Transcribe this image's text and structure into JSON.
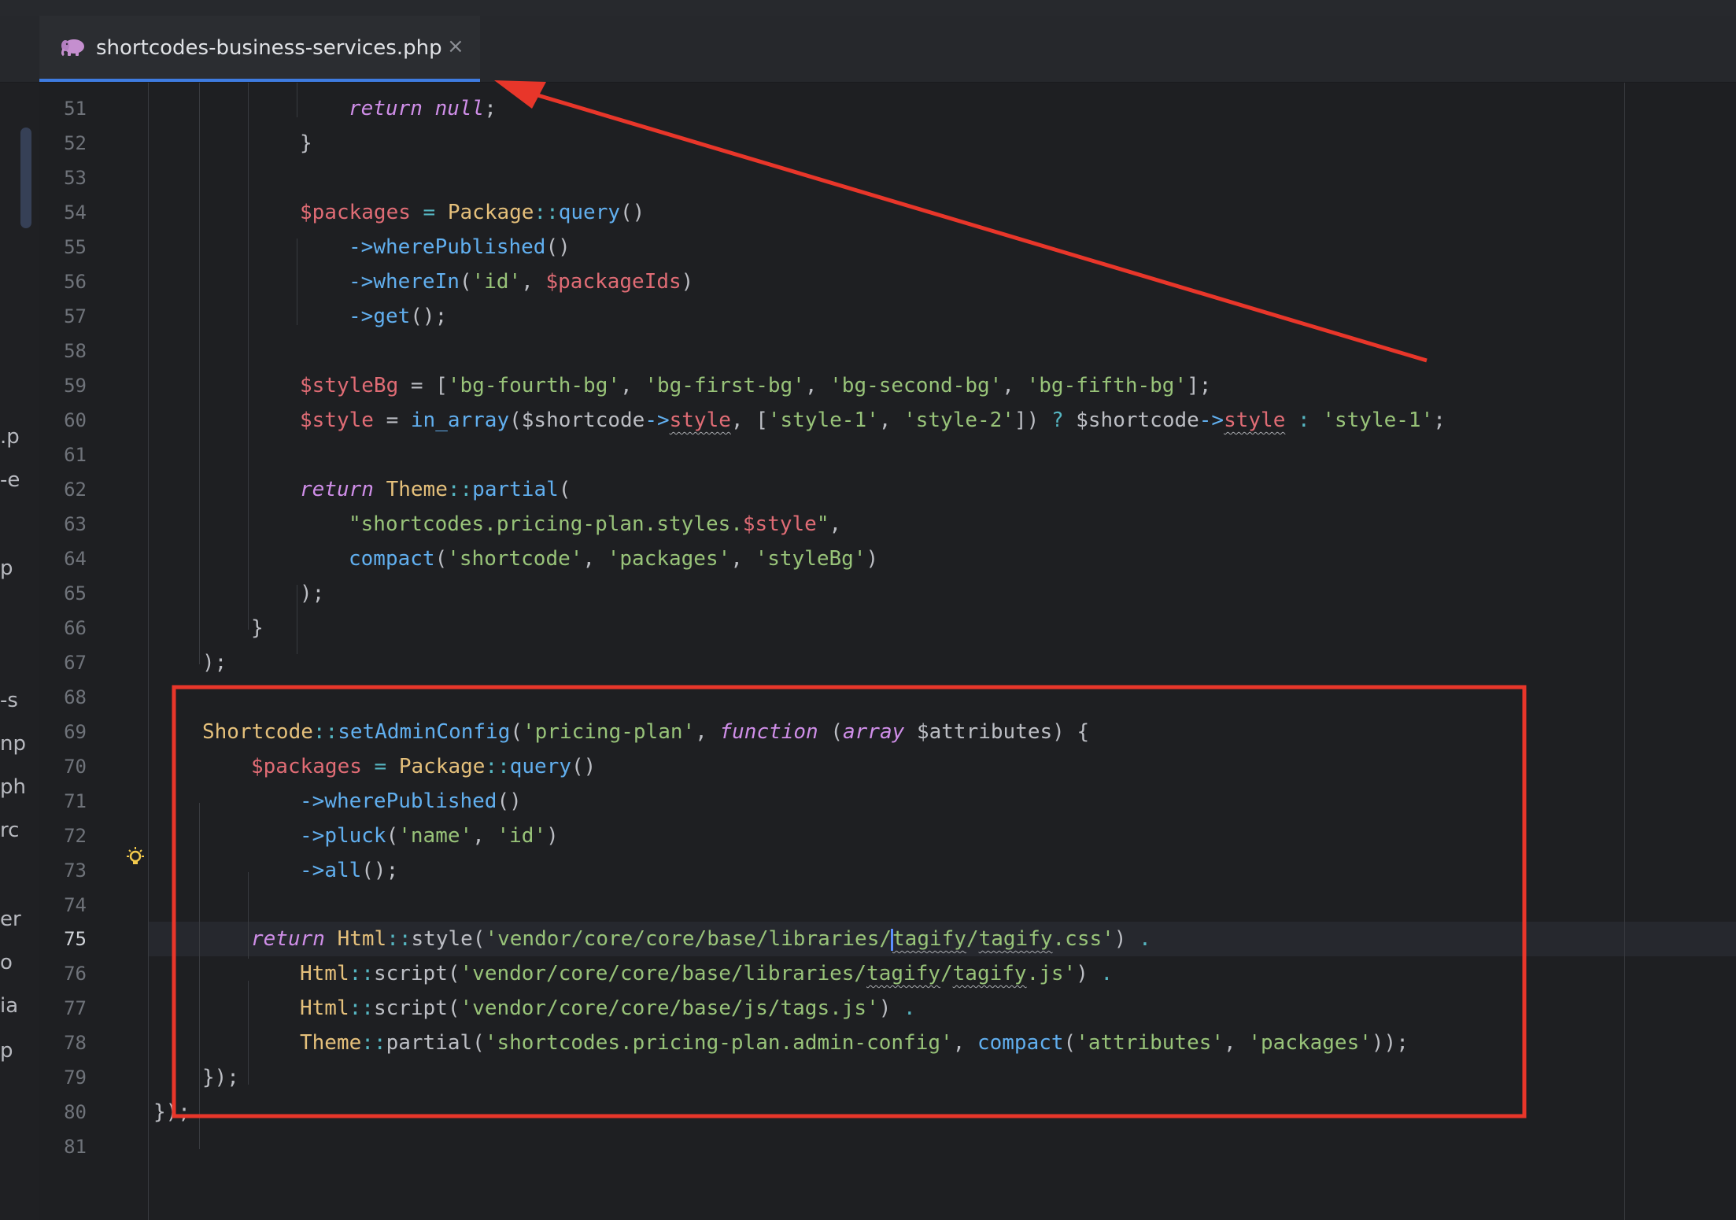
{
  "tab": {
    "file_name": "shortcodes-business-services.php",
    "close_symbol": "×",
    "icon": "php-elephant-icon"
  },
  "left_panel_fragments": [
    ".p",
    "-e",
    "p",
    "-s",
    "np",
    "ph",
    "rc",
    "er",
    "o",
    "ia",
    "p"
  ],
  "editor": {
    "active_line": "75",
    "line_numbers": [
      "51",
      "52",
      "53",
      "54",
      "55",
      "56",
      "57",
      "58",
      "59",
      "60",
      "61",
      "62",
      "63",
      "64",
      "65",
      "66",
      "67",
      "68",
      "69",
      "70",
      "71",
      "72",
      "73",
      "74",
      "75",
      "76",
      "77",
      "78",
      "79",
      "80",
      "81"
    ],
    "code": {
      "l51": {
        "a": "return",
        "b": " ",
        "c": "null",
        "d": ";"
      },
      "l52": {
        "a": "}"
      },
      "l54": {
        "a": "$packages",
        "b": " = ",
        "c": "Package",
        "d": "::",
        "e": "query",
        "f": "()"
      },
      "l55": {
        "a": "->",
        "b": "wherePublished",
        "c": "()"
      },
      "l56": {
        "a": "->",
        "b": "whereIn",
        "c": "(",
        "d": "'id'",
        "e": ", ",
        "f": "$packageIds",
        "g": ")"
      },
      "l57": {
        "a": "->",
        "b": "get",
        "c": "();"
      },
      "l59": {
        "a": "$styleBg",
        "b": " = [",
        "c": "'bg-fourth-bg'",
        "d": ", ",
        "e": "'bg-first-bg'",
        "f": ", ",
        "g": "'bg-second-bg'",
        "h": ", ",
        "i": "'bg-fifth-bg'",
        "j": "];"
      },
      "l60": {
        "a": "$style",
        "b": " = ",
        "c": "in_array",
        "d": "($shortcode",
        "e": "->",
        "f": "style",
        "g": ", [",
        "h": "'style-1'",
        "i": ", ",
        "j": "'style-2'",
        "k": "]) ",
        "l": "?",
        "m": " $shortcode",
        "n": "->",
        "o": "style",
        "p": " ",
        "q": ":",
        "r": " ",
        "s": "'style-1'",
        "t": ";"
      },
      "l62": {
        "a": "return",
        "b": " ",
        "c": "Theme",
        "d": "::",
        "e": "partial",
        "f": "("
      },
      "l63": {
        "a": "\"shortcodes.pricing-plan.styles.",
        "b": "$style",
        "c": "\"",
        "d": ","
      },
      "l64": {
        "a": "compact",
        "b": "(",
        "c": "'shortcode'",
        "d": ", ",
        "e": "'packages'",
        "f": ", ",
        "g": "'styleBg'",
        "h": ")"
      },
      "l65": {
        "a": ");"
      },
      "l66": {
        "a": "}"
      },
      "l67": {
        "a": ");"
      },
      "l69": {
        "a": "Shortcode",
        "b": "::",
        "c": "setAdminConfig",
        "d": "(",
        "e": "'pricing-plan'",
        "f": ", ",
        "g": "function",
        "h": " (",
        "i": "array",
        "j": " $attributes) {"
      },
      "l70": {
        "a": "$packages",
        "b": " = ",
        "c": "Package",
        "d": "::",
        "e": "query",
        "f": "()"
      },
      "l71": {
        "a": "->",
        "b": "wherePublished",
        "c": "()"
      },
      "l72": {
        "a": "->",
        "b": "pluck",
        "c": "(",
        "d": "'name'",
        "e": ", ",
        "f": "'id'",
        "g": ")"
      },
      "l73": {
        "a": "->",
        "b": "all",
        "c": "();"
      },
      "l75": {
        "a": "return",
        "b": " ",
        "c": "Html",
        "d": "::",
        "e": "style",
        "f": "(",
        "g": "'vendor/core/core/base/libraries/",
        "h": "tagify",
        "i": "/",
        "j": "tagify",
        "k": ".css'",
        "l": ") ",
        "m": "."
      },
      "l76": {
        "a": "Html",
        "b": "::",
        "c": "script",
        "d": "(",
        "e": "'vendor/core/core/base/libraries/",
        "f": "tagify",
        "g": "/",
        "h": "tagify",
        "i": ".js'",
        "j": ") ",
        "k": "."
      },
      "l77": {
        "a": "Html",
        "b": "::",
        "c": "script",
        "d": "(",
        "e": "'vendor/core/core/base/js/tags.js'",
        "f": ") ",
        "g": "."
      },
      "l78": {
        "a": "Theme",
        "b": "::",
        "c": "partial",
        "d": "(",
        "e": "'shortcodes.pricing-plan.admin-config'",
        "f": ", ",
        "g": "compact",
        "h": "(",
        "i": "'attributes'",
        "j": ", ",
        "k": "'packages'",
        "l": "));"
      },
      "l79": {
        "a": "});"
      },
      "l80": {
        "a": "});"
      }
    }
  },
  "colors": {
    "annotation_red": "#e8362a",
    "tab_underline": "#3e7be0"
  }
}
